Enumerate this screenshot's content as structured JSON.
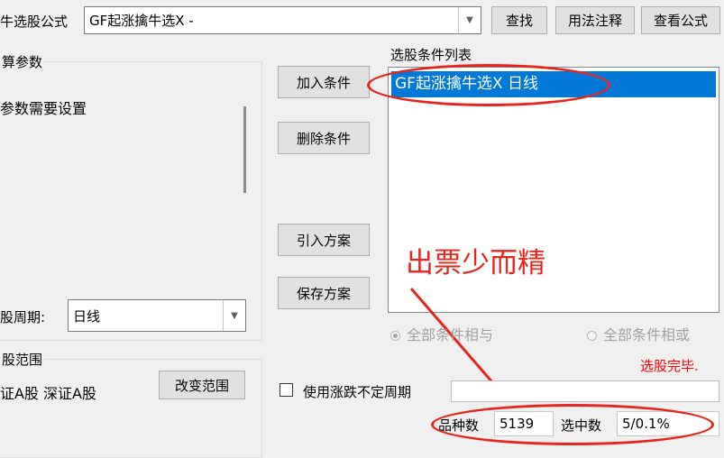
{
  "top": {
    "formula_label": "牛选股公式",
    "formula_value": "GF起涨擒牛选X  -",
    "find_button": "查找",
    "usage_button": "用法注释",
    "view_formula_button": "查看公式"
  },
  "params": {
    "group_title": "算参数",
    "note": "参数需要设置"
  },
  "middle_buttons": {
    "add": "加入条件",
    "delete": "删除条件",
    "import": "引入方案",
    "save": "保存方案"
  },
  "conditions": {
    "title": "选股条件列表",
    "items": [
      "GF起涨擒牛选X  日线"
    ]
  },
  "period": {
    "label": "股周期:",
    "value": "日线"
  },
  "range": {
    "group_title": "股范围",
    "value": "证A股 深证A股",
    "change_button": "改变范围"
  },
  "logic": {
    "and_label": "全部条件相与",
    "or_label": "全部条件相或",
    "selected": "and"
  },
  "status": "选股完毕.",
  "variable_period_checkbox": {
    "label": "使用涨跌不定周期",
    "checked": false
  },
  "stats": {
    "count_label": "品种数",
    "count_value": "5139",
    "selected_label": "选中数",
    "selected_value": "5/0.1%"
  },
  "annotation": {
    "text": "出票少而精",
    "color": "#e8251c"
  },
  "colors": {
    "selection": "#0078d7",
    "status_red": "#ff0000"
  }
}
